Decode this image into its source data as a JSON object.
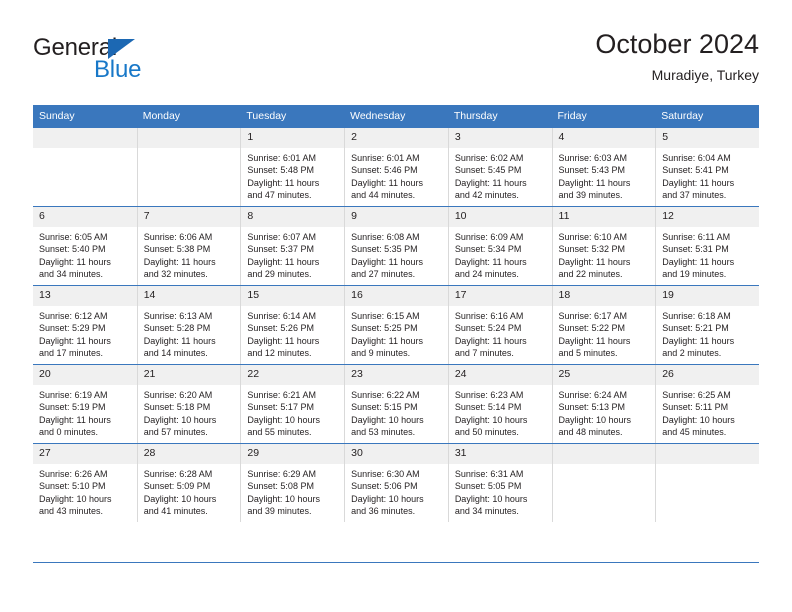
{
  "brand": {
    "name_part1": "General",
    "name_part2": "Blue",
    "triangle_color": "#1c68b3",
    "blue_color": "#1878c8"
  },
  "header": {
    "title": "October 2024",
    "subtitle": "Muradiye, Turkey"
  },
  "theme": {
    "header_bg": "#3a77bd",
    "daynum_bg": "#f0f0f0",
    "text": "#231f20"
  },
  "weekdays": [
    "Sunday",
    "Monday",
    "Tuesday",
    "Wednesday",
    "Thursday",
    "Friday",
    "Saturday"
  ],
  "weeks": [
    [
      {
        "day": "",
        "sunrise": "",
        "sunset": "",
        "daylight1": "",
        "daylight2": ""
      },
      {
        "day": "",
        "sunrise": "",
        "sunset": "",
        "daylight1": "",
        "daylight2": ""
      },
      {
        "day": "1",
        "sunrise": "Sunrise: 6:01 AM",
        "sunset": "Sunset: 5:48 PM",
        "daylight1": "Daylight: 11 hours",
        "daylight2": "and 47 minutes."
      },
      {
        "day": "2",
        "sunrise": "Sunrise: 6:01 AM",
        "sunset": "Sunset: 5:46 PM",
        "daylight1": "Daylight: 11 hours",
        "daylight2": "and 44 minutes."
      },
      {
        "day": "3",
        "sunrise": "Sunrise: 6:02 AM",
        "sunset": "Sunset: 5:45 PM",
        "daylight1": "Daylight: 11 hours",
        "daylight2": "and 42 minutes."
      },
      {
        "day": "4",
        "sunrise": "Sunrise: 6:03 AM",
        "sunset": "Sunset: 5:43 PM",
        "daylight1": "Daylight: 11 hours",
        "daylight2": "and 39 minutes."
      },
      {
        "day": "5",
        "sunrise": "Sunrise: 6:04 AM",
        "sunset": "Sunset: 5:41 PM",
        "daylight1": "Daylight: 11 hours",
        "daylight2": "and 37 minutes."
      }
    ],
    [
      {
        "day": "6",
        "sunrise": "Sunrise: 6:05 AM",
        "sunset": "Sunset: 5:40 PM",
        "daylight1": "Daylight: 11 hours",
        "daylight2": "and 34 minutes."
      },
      {
        "day": "7",
        "sunrise": "Sunrise: 6:06 AM",
        "sunset": "Sunset: 5:38 PM",
        "daylight1": "Daylight: 11 hours",
        "daylight2": "and 32 minutes."
      },
      {
        "day": "8",
        "sunrise": "Sunrise: 6:07 AM",
        "sunset": "Sunset: 5:37 PM",
        "daylight1": "Daylight: 11 hours",
        "daylight2": "and 29 minutes."
      },
      {
        "day": "9",
        "sunrise": "Sunrise: 6:08 AM",
        "sunset": "Sunset: 5:35 PM",
        "daylight1": "Daylight: 11 hours",
        "daylight2": "and 27 minutes."
      },
      {
        "day": "10",
        "sunrise": "Sunrise: 6:09 AM",
        "sunset": "Sunset: 5:34 PM",
        "daylight1": "Daylight: 11 hours",
        "daylight2": "and 24 minutes."
      },
      {
        "day": "11",
        "sunrise": "Sunrise: 6:10 AM",
        "sunset": "Sunset: 5:32 PM",
        "daylight1": "Daylight: 11 hours",
        "daylight2": "and 22 minutes."
      },
      {
        "day": "12",
        "sunrise": "Sunrise: 6:11 AM",
        "sunset": "Sunset: 5:31 PM",
        "daylight1": "Daylight: 11 hours",
        "daylight2": "and 19 minutes."
      }
    ],
    [
      {
        "day": "13",
        "sunrise": "Sunrise: 6:12 AM",
        "sunset": "Sunset: 5:29 PM",
        "daylight1": "Daylight: 11 hours",
        "daylight2": "and 17 minutes."
      },
      {
        "day": "14",
        "sunrise": "Sunrise: 6:13 AM",
        "sunset": "Sunset: 5:28 PM",
        "daylight1": "Daylight: 11 hours",
        "daylight2": "and 14 minutes."
      },
      {
        "day": "15",
        "sunrise": "Sunrise: 6:14 AM",
        "sunset": "Sunset: 5:26 PM",
        "daylight1": "Daylight: 11 hours",
        "daylight2": "and 12 minutes."
      },
      {
        "day": "16",
        "sunrise": "Sunrise: 6:15 AM",
        "sunset": "Sunset: 5:25 PM",
        "daylight1": "Daylight: 11 hours",
        "daylight2": "and 9 minutes."
      },
      {
        "day": "17",
        "sunrise": "Sunrise: 6:16 AM",
        "sunset": "Sunset: 5:24 PM",
        "daylight1": "Daylight: 11 hours",
        "daylight2": "and 7 minutes."
      },
      {
        "day": "18",
        "sunrise": "Sunrise: 6:17 AM",
        "sunset": "Sunset: 5:22 PM",
        "daylight1": "Daylight: 11 hours",
        "daylight2": "and 5 minutes."
      },
      {
        "day": "19",
        "sunrise": "Sunrise: 6:18 AM",
        "sunset": "Sunset: 5:21 PM",
        "daylight1": "Daylight: 11 hours",
        "daylight2": "and 2 minutes."
      }
    ],
    [
      {
        "day": "20",
        "sunrise": "Sunrise: 6:19 AM",
        "sunset": "Sunset: 5:19 PM",
        "daylight1": "Daylight: 11 hours",
        "daylight2": "and 0 minutes."
      },
      {
        "day": "21",
        "sunrise": "Sunrise: 6:20 AM",
        "sunset": "Sunset: 5:18 PM",
        "daylight1": "Daylight: 10 hours",
        "daylight2": "and 57 minutes."
      },
      {
        "day": "22",
        "sunrise": "Sunrise: 6:21 AM",
        "sunset": "Sunset: 5:17 PM",
        "daylight1": "Daylight: 10 hours",
        "daylight2": "and 55 minutes."
      },
      {
        "day": "23",
        "sunrise": "Sunrise: 6:22 AM",
        "sunset": "Sunset: 5:15 PM",
        "daylight1": "Daylight: 10 hours",
        "daylight2": "and 53 minutes."
      },
      {
        "day": "24",
        "sunrise": "Sunrise: 6:23 AM",
        "sunset": "Sunset: 5:14 PM",
        "daylight1": "Daylight: 10 hours",
        "daylight2": "and 50 minutes."
      },
      {
        "day": "25",
        "sunrise": "Sunrise: 6:24 AM",
        "sunset": "Sunset: 5:13 PM",
        "daylight1": "Daylight: 10 hours",
        "daylight2": "and 48 minutes."
      },
      {
        "day": "26",
        "sunrise": "Sunrise: 6:25 AM",
        "sunset": "Sunset: 5:11 PM",
        "daylight1": "Daylight: 10 hours",
        "daylight2": "and 45 minutes."
      }
    ],
    [
      {
        "day": "27",
        "sunrise": "Sunrise: 6:26 AM",
        "sunset": "Sunset: 5:10 PM",
        "daylight1": "Daylight: 10 hours",
        "daylight2": "and 43 minutes."
      },
      {
        "day": "28",
        "sunrise": "Sunrise: 6:28 AM",
        "sunset": "Sunset: 5:09 PM",
        "daylight1": "Daylight: 10 hours",
        "daylight2": "and 41 minutes."
      },
      {
        "day": "29",
        "sunrise": "Sunrise: 6:29 AM",
        "sunset": "Sunset: 5:08 PM",
        "daylight1": "Daylight: 10 hours",
        "daylight2": "and 39 minutes."
      },
      {
        "day": "30",
        "sunrise": "Sunrise: 6:30 AM",
        "sunset": "Sunset: 5:06 PM",
        "daylight1": "Daylight: 10 hours",
        "daylight2": "and 36 minutes."
      },
      {
        "day": "31",
        "sunrise": "Sunrise: 6:31 AM",
        "sunset": "Sunset: 5:05 PM",
        "daylight1": "Daylight: 10 hours",
        "daylight2": "and 34 minutes."
      },
      {
        "day": "",
        "sunrise": "",
        "sunset": "",
        "daylight1": "",
        "daylight2": ""
      },
      {
        "day": "",
        "sunrise": "",
        "sunset": "",
        "daylight1": "",
        "daylight2": ""
      }
    ]
  ]
}
